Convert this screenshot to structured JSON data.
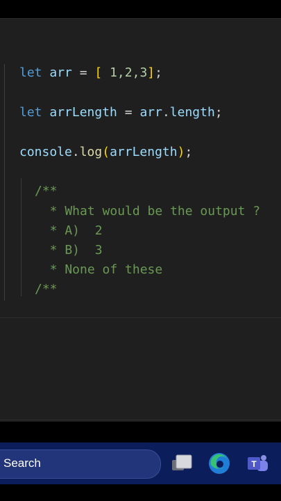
{
  "code": {
    "line1": {
      "kw": "let",
      "var": "arr",
      "eq": "=",
      "open": "[",
      "values": "1,2,3",
      "close": "]",
      "semi": ";"
    },
    "line2": {
      "kw": "let",
      "var": "arrLength",
      "eq": "=",
      "obj": "arr",
      "dot": ".",
      "prop": "length",
      "semi": ";"
    },
    "line3": {
      "obj": "console",
      "dot": ".",
      "fn": "log",
      "open": "(",
      "arg": "arrLength",
      "close": ")",
      "semi": ";"
    },
    "comment": [
      "/**",
      "  * What would be the output ?",
      "  * A)  2",
      "  * B)  3",
      "  * None of these",
      "/**"
    ]
  },
  "taskbar": {
    "search_label": "Search",
    "icons": [
      "task-view-icon",
      "edge-icon",
      "teams-icon"
    ]
  },
  "colors": {
    "editor_bg": "#1f1f1f",
    "keyword": "#569cd6",
    "variable": "#9cdcfe",
    "function": "#dcdcaa",
    "number": "#b5cea8",
    "comment": "#6a9955",
    "bracket": "#ffd700",
    "taskbar_bg": "#0b1d5a"
  }
}
